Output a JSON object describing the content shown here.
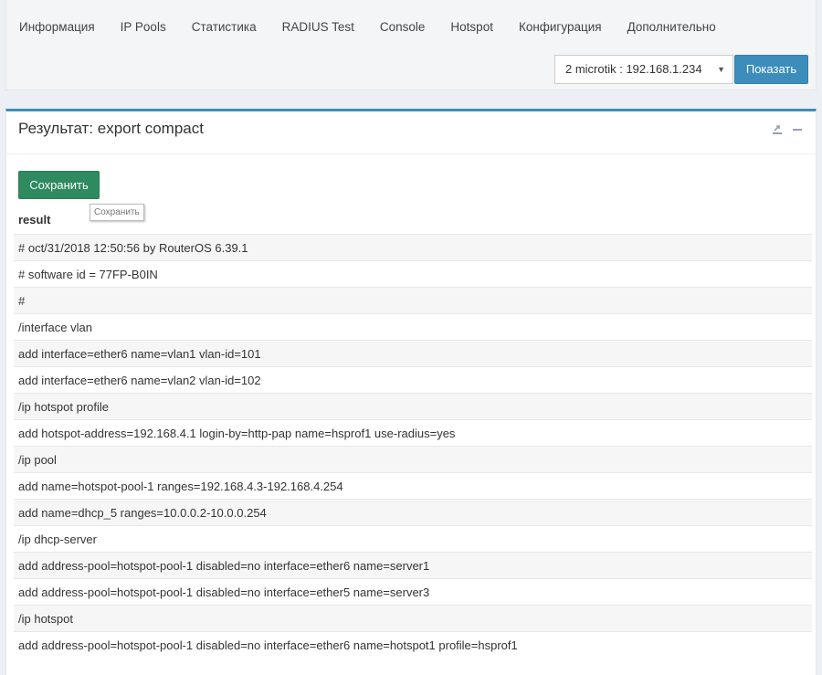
{
  "tabs": [
    "Информация",
    "IP Pools",
    "Статистика",
    "RADIUS Test",
    "Console",
    "Hotspot",
    "Конфигурация",
    "Дополнительно"
  ],
  "router_select": {
    "value": "2 microtik : 192.168.1.234"
  },
  "show_button": "Показать",
  "panel": {
    "title": "Результат: export compact",
    "save_button": "Сохранить",
    "save_tooltip": "Сохранить",
    "result_header": "result",
    "rows": [
      "# oct/31/2018 12:50:56 by RouterOS 6.39.1",
      "# software id = 77FP-B0IN",
      "#",
      "/interface vlan",
      "add interface=ether6 name=vlan1 vlan-id=101",
      "add interface=ether6 name=vlan2 vlan-id=102",
      "/ip hotspot profile",
      "add hotspot-address=192.168.4.1 login-by=http-pap name=hsprof1 use-radius=yes",
      "/ip pool",
      "add name=hotspot-pool-1 ranges=192.168.4.3-192.168.4.254",
      "add name=dhcp_5 ranges=10.0.0.2-10.0.0.254",
      "/ip dhcp-server",
      "add address-pool=hotspot-pool-1 disabled=no interface=ether6 name=server1",
      "add address-pool=hotspot-pool-1 disabled=no interface=ether5 name=server3",
      "/ip hotspot",
      "add address-pool=hotspot-pool-1 disabled=no interface=ether6 name=hotspot1 profile=hsprof1"
    ]
  }
}
